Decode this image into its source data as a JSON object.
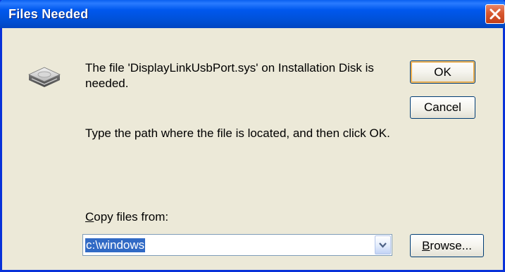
{
  "window": {
    "title": "Files Needed"
  },
  "message": {
    "text": "The file 'DisplayLinkUsbPort.sys' on Installation Disk is needed.",
    "instruction": "Type the path where the file is located, and then click OK."
  },
  "buttons": {
    "ok": "OK",
    "cancel": "Cancel",
    "browse_underlined": "B",
    "browse_rest": "rowse..."
  },
  "copy_from": {
    "label_underlined": "C",
    "label_rest": "opy files from:",
    "value": "c:\\windows"
  },
  "icons": {
    "close": "close-icon",
    "disk": "disk-drive-icon",
    "dropdown": "chevron-down-icon"
  },
  "colors": {
    "titlebar": "#0058ee",
    "close_button": "#d8572e",
    "selection": "#316ac5",
    "dialog_background": "#ece9d8"
  }
}
